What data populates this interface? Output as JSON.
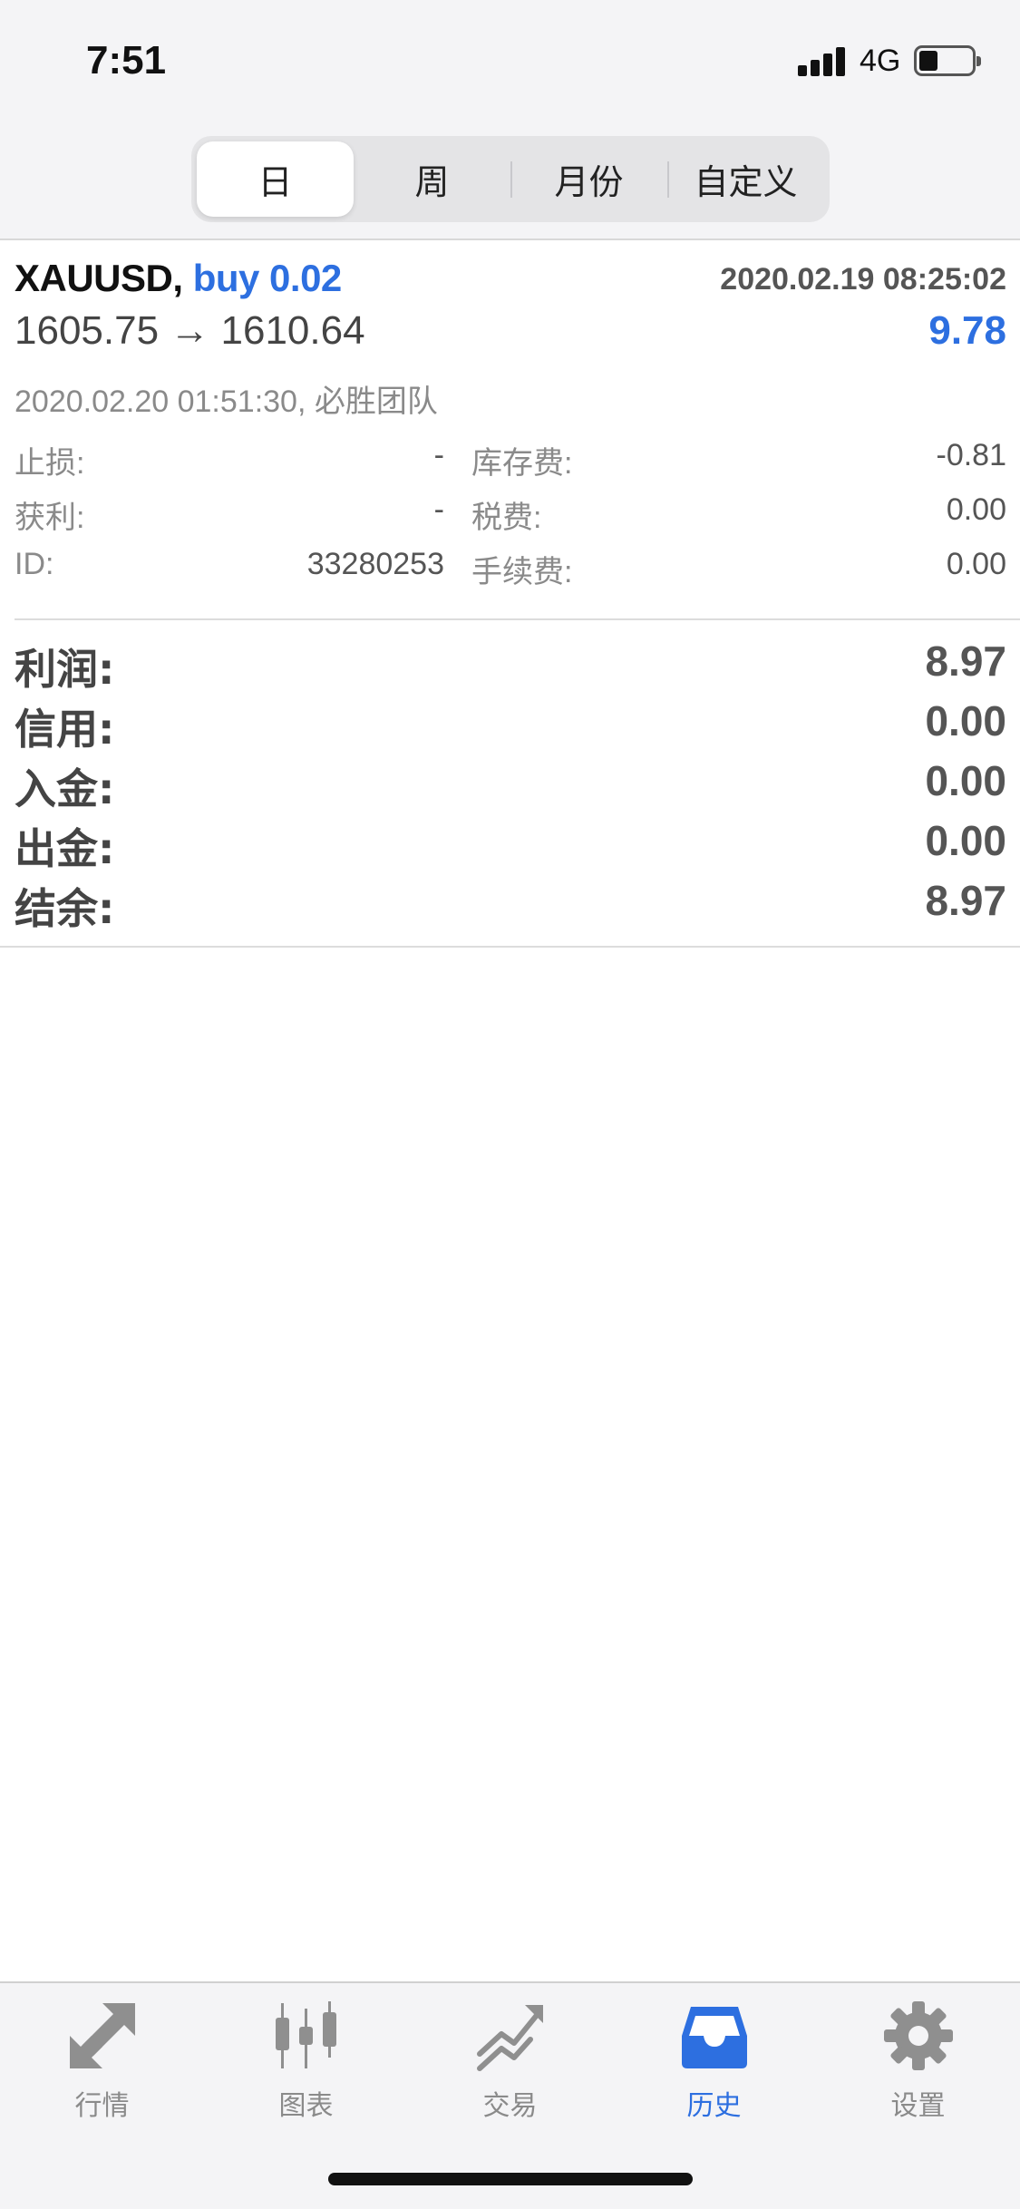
{
  "status_bar": {
    "time": "7:51",
    "network": "4G"
  },
  "period_tabs": [
    {
      "label": "日",
      "active": true
    },
    {
      "label": "周",
      "active": false
    },
    {
      "label": "月份",
      "active": false
    },
    {
      "label": "自定义",
      "active": false
    }
  ],
  "deal": {
    "symbol": "XAUUSD,",
    "action": "buy 0.02",
    "open_time": "2020.02.19 08:25:02",
    "price_open_close": "1605.75 → 1610.64",
    "profit": "9.78",
    "close_info": "2020.02.20 01:51:30, 必胜团队",
    "details": {
      "stop_loss_label": "止损:",
      "stop_loss_value": "-",
      "take_profit_label": "获利:",
      "take_profit_value": "-",
      "id_label": "ID:",
      "id_value": "33280253",
      "swap_label": "库存费:",
      "swap_value": "-0.81",
      "tax_label": "税费:",
      "tax_value": "0.00",
      "commission_label": "手续费:",
      "commission_value": "0.00"
    }
  },
  "summary": [
    {
      "label": "利润:",
      "value": "8.97"
    },
    {
      "label": "信用:",
      "value": "0.00"
    },
    {
      "label": "入金:",
      "value": "0.00"
    },
    {
      "label": "出金:",
      "value": "0.00"
    },
    {
      "label": "结余:",
      "value": "8.97"
    }
  ],
  "tab_bar": [
    {
      "label": "行情",
      "icon": "quotes-arrows-icon",
      "active": false
    },
    {
      "label": "图表",
      "icon": "candlestick-chart-icon",
      "active": false
    },
    {
      "label": "交易",
      "icon": "trade-trend-icon",
      "active": false
    },
    {
      "label": "历史",
      "icon": "history-inbox-icon",
      "active": true
    },
    {
      "label": "设置",
      "icon": "gear-icon",
      "active": false
    }
  ],
  "colors": {
    "accent": "#2d6fe0",
    "muted": "#8a8a8a",
    "inactive_icon": "#8f8f8f"
  }
}
